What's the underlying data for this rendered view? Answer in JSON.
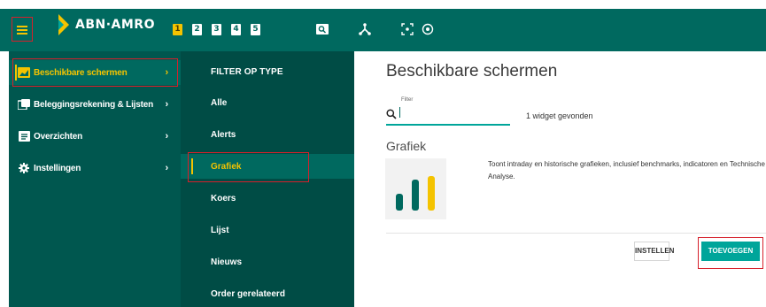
{
  "brand": {
    "name": "ABN·AMRO",
    "colors": {
      "primary": "#00695f",
      "dark": "#00574f",
      "darker": "#004c45",
      "accent": "#f4c300",
      "teal": "#00a59a",
      "highlight": "#d6202b"
    }
  },
  "topbar": {
    "menu_icon": "hamburger-icon",
    "workspaces": [
      "1",
      "2",
      "3",
      "4",
      "5"
    ],
    "active_workspace": "1",
    "icons": [
      "search-icon",
      "network-icon",
      "focus-icon",
      "target-icon"
    ]
  },
  "sidebar": {
    "items": [
      {
        "label": "Beschikbare schermen",
        "icon": "screen-icon",
        "active": true
      },
      {
        "label": "Beleggingsrekening & Lijsten",
        "icon": "copy-icon",
        "active": false
      },
      {
        "label": "Overzichten",
        "icon": "list-icon",
        "active": false
      },
      {
        "label": "Instellingen",
        "icon": "gear-icon",
        "active": false
      }
    ]
  },
  "filter": {
    "title": "FILTER OP TYPE",
    "items": [
      {
        "label": "Alle",
        "active": false
      },
      {
        "label": "Alerts",
        "active": false
      },
      {
        "label": "Grafiek",
        "active": true
      },
      {
        "label": "Koers",
        "active": false
      },
      {
        "label": "Lijst",
        "active": false
      },
      {
        "label": "Nieuws",
        "active": false
      },
      {
        "label": "Order gerelateerd",
        "active": false
      }
    ]
  },
  "main": {
    "title": "Beschikbare schermen",
    "search": {
      "label": "Filter",
      "value": "",
      "icon": "search-icon"
    },
    "result_count": "1 widget gevonden",
    "widget": {
      "title": "Grafiek",
      "icon": "bar-chart-icon",
      "description": "Toont intraday en historische grafieken, inclusief benchmarks, indicatoren en Technische Analyse."
    },
    "buttons": {
      "configure": "INSTELLEN",
      "add": "TOEVOEGEN"
    }
  }
}
